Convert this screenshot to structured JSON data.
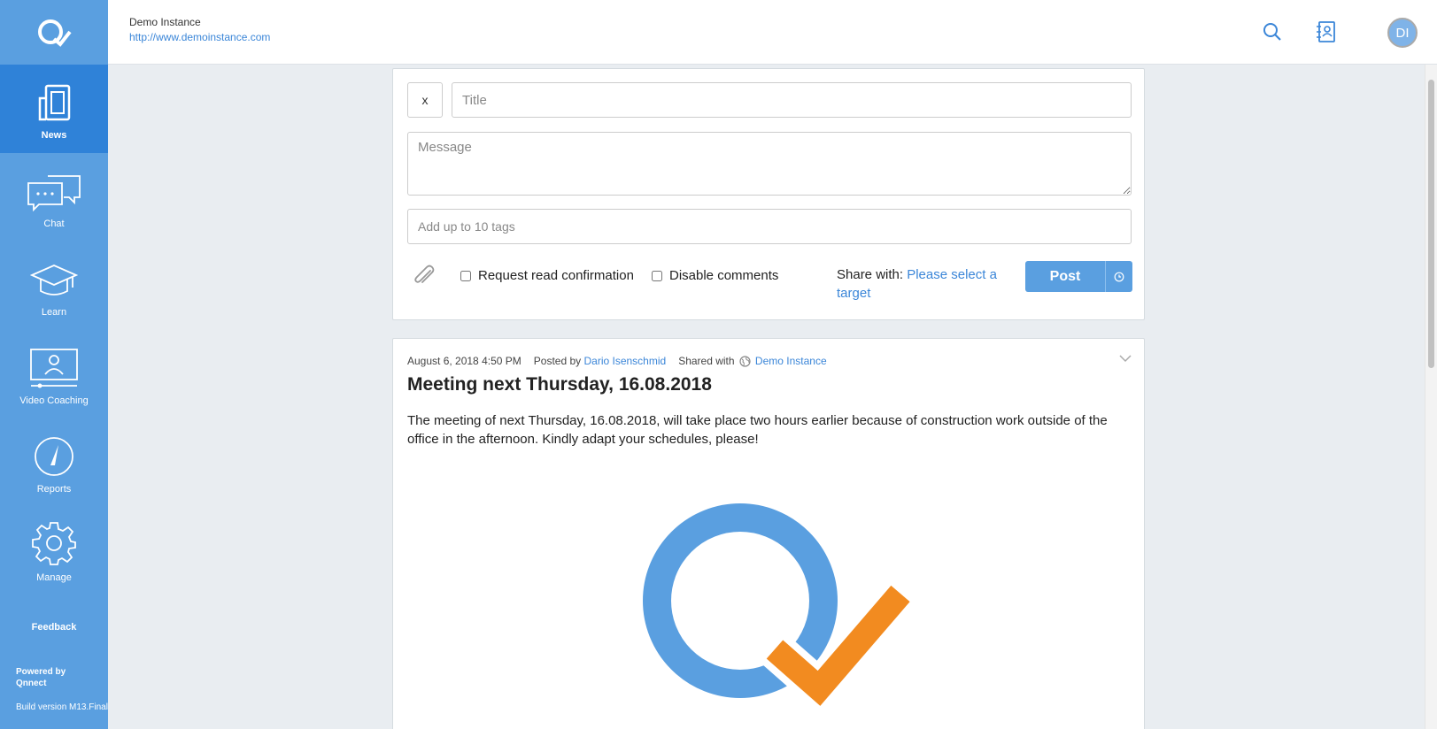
{
  "sidebar": {
    "nav": [
      {
        "label": "News",
        "icon": "news-icon"
      },
      {
        "label": "Chat",
        "icon": "chat-icon"
      },
      {
        "label": "Learn",
        "icon": "graduation-cap-icon"
      },
      {
        "label": "Video Coaching",
        "icon": "video-coaching-icon"
      },
      {
        "label": "Reports",
        "icon": "gauge-icon"
      },
      {
        "label": "Manage",
        "icon": "gear-icon"
      }
    ],
    "feedback": "Feedback",
    "powered_line1": "Powered by",
    "powered_line2": "Qnnect",
    "build": "Build version M13.Final"
  },
  "header": {
    "instance_name": "Demo Instance",
    "instance_url": "http://www.demoinstance.com",
    "avatar_initials": "DI"
  },
  "composer": {
    "close_label": "x",
    "title_placeholder": "Title",
    "message_placeholder": "Message",
    "tags_placeholder": "Add up to 10 tags",
    "read_confirmation_label": "Request read confirmation",
    "disable_comments_label": "Disable comments",
    "share_with_label": "Share with:",
    "share_target": "Please select a target",
    "post_label": "Post"
  },
  "post": {
    "date": "August 6, 2018 4:50 PM",
    "posted_by_label": "Posted by",
    "author": "Dario Isenschmid",
    "shared_with_label": "Shared with",
    "shared_target": "Demo Instance",
    "title": "Meeting next Thursday, 16.08.2018",
    "body": "The meeting of next Thursday, 16.08.2018, will take place two hours earlier because of construction work outside of the office in the afternoon. Kindly adapt your schedules, please!"
  },
  "colors": {
    "sidebar": "#5a9fe0",
    "sidebar_active": "#2f82d8",
    "accent": "#3b86d8",
    "logo_orange": "#f28b20"
  }
}
